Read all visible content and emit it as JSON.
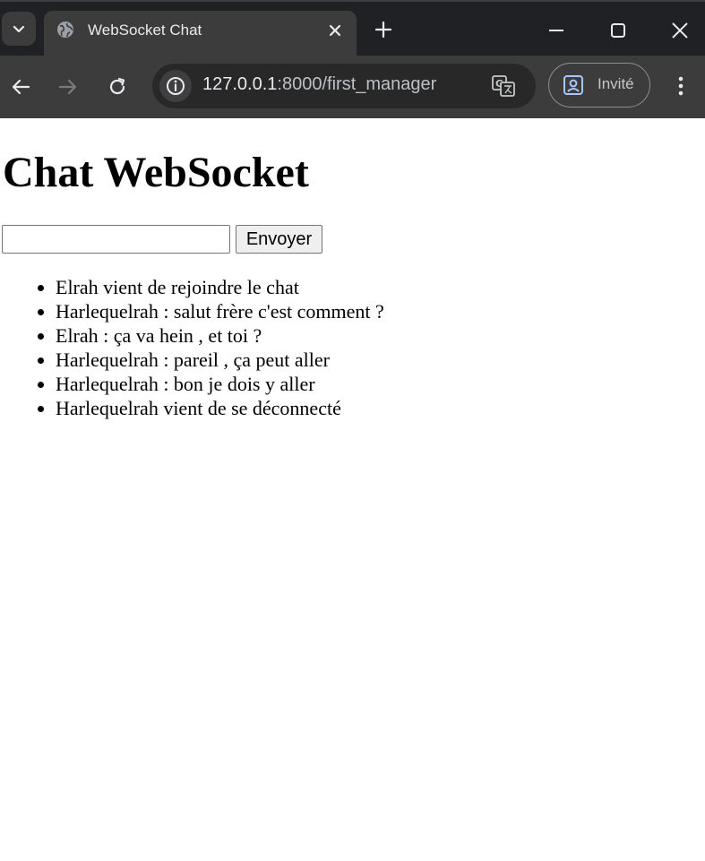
{
  "browser": {
    "tab_title": "WebSocket Chat",
    "url_host": "127.0.0.1",
    "url_path": ":8000/first_manager",
    "profile_label": "Invité"
  },
  "page": {
    "heading": "Chat WebSocket",
    "input": {
      "value": "",
      "placeholder": ""
    },
    "send_label": "Envoyer",
    "messages": [
      "Elrah vient de rejoindre le chat",
      "Harlequelrah : salut frère c'est comment ?",
      "Elrah : ça va hein , et toi ?",
      "Harlequelrah : pareil , ça peut aller",
      "Harlequelrah : bon je dois y aller",
      "Harlequelrah vient de se déconnecté"
    ]
  },
  "colors": {
    "tabstrip_bg": "#202124",
    "toolbar_bg": "#3c3c3c",
    "omnibox_bg": "#282828",
    "page_bg": "#ffffff"
  },
  "icons": [
    "tab-search-icon",
    "globe-icon",
    "close-icon",
    "plus-icon",
    "minimize-icon",
    "maximize-icon",
    "window-close-icon",
    "back-arrow-icon",
    "forward-arrow-icon",
    "reload-icon",
    "info-icon",
    "translate-icon",
    "profile-icon",
    "more-vert-icon"
  ]
}
